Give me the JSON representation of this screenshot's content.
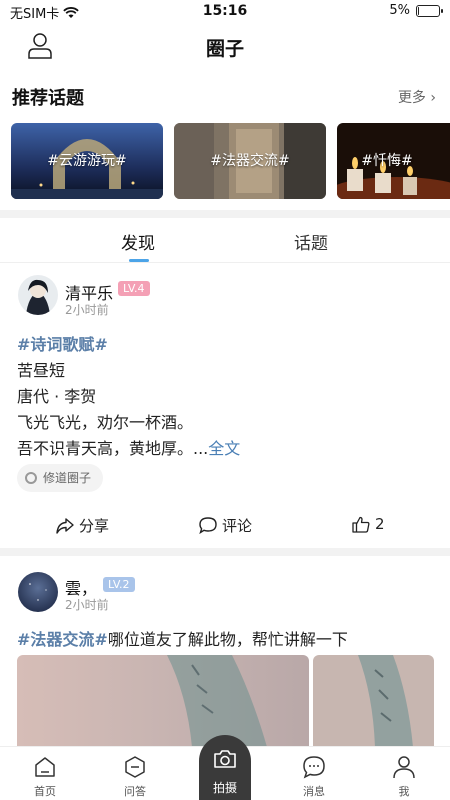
{
  "status_bar": {
    "carrier": "无SIM卡",
    "time": "15:16",
    "battery": "5%",
    "battery_level": 0.05
  },
  "header": {
    "title": "圈子"
  },
  "recommended": {
    "title": "推荐话题",
    "more_label": "更多",
    "topics": [
      {
        "label": "#云游游玩#"
      },
      {
        "label": "#法器交流#"
      },
      {
        "label": "#忏悔#"
      }
    ]
  },
  "tabs": [
    {
      "label": "发现",
      "active": true
    },
    {
      "label": "话题",
      "active": false
    }
  ],
  "posts": [
    {
      "author": "清平乐",
      "level": "LV.4",
      "level_color": "#f4a0b5",
      "time": "2小时前",
      "hashtag": "#诗词歌赋#",
      "lines": [
        "苦昼短",
        "唐代 · 李贺",
        "飞光飞光，劝尔一杯酒。",
        "吾不识青天高，黄地厚。..."
      ],
      "more_label": "全文",
      "circle": "修道圈子",
      "share_label": "分享",
      "comment_label": "评论",
      "like_count": "2"
    },
    {
      "author": "雲，",
      "level": "LV.2",
      "level_color": "#a9c4ea",
      "time": "2小时前",
      "hashtag": "#法器交流#",
      "text": "哪位道友了解此物，帮忙讲解一下"
    }
  ],
  "bottom_nav": {
    "home": "首页",
    "qa": "问答",
    "camera": "拍摄",
    "messages": "消息",
    "me": "我"
  },
  "colors": {
    "accent": "#4ca4e8",
    "hashtag": "#5b7fa8",
    "link": "#4a7fb5"
  }
}
